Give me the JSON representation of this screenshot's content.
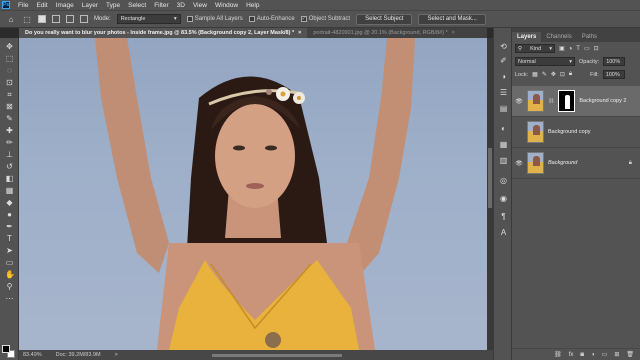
{
  "menubar": {
    "items": [
      "File",
      "Edit",
      "Image",
      "Layer",
      "Type",
      "Select",
      "Filter",
      "3D",
      "View",
      "Window",
      "Help"
    ]
  },
  "options": {
    "mode_label": "Mode:",
    "mode_value": "Rectangle",
    "sample_all_layers": "Sample All Layers",
    "auto_enhance": "Auto-Enhance",
    "object_subtract": "Object Subtract",
    "select_subject": "Select Subject",
    "select_and_mask": "Select and Mask..."
  },
  "tabs": [
    {
      "label": "Do you really want to blur your photos - Inside frame.jpg @ 83.5% (Background copy 2, Layer Mask/8) *",
      "close": "×"
    },
    {
      "label": "portrait-4820901.jpg @ 20.1% (Background, RGB/8#) *",
      "close": "×"
    }
  ],
  "status": {
    "zoom": "83.49%",
    "doc": "Doc: 39.2M/83.9M",
    "more": ">"
  },
  "layers_panel": {
    "tabs": [
      "Layers",
      "Channels",
      "Paths"
    ],
    "kind_label": "Kind",
    "blend_mode": "Normal",
    "opacity_label": "Opacity:",
    "opacity_value": "100%",
    "lock_label": "Lock:",
    "fill_label": "Fill:",
    "fill_value": "100%",
    "layers": [
      {
        "name": "Background copy 2",
        "visible": true,
        "selected": true,
        "has_mask": true
      },
      {
        "name": "Background copy",
        "visible": false,
        "selected": false,
        "has_mask": false
      },
      {
        "name": "Background",
        "visible": true,
        "selected": false,
        "has_mask": false,
        "locked": true
      }
    ],
    "footer_icons": [
      "link-icon",
      "fx-icon",
      "mask-icon",
      "adjustment-icon",
      "group-icon",
      "new-layer-icon",
      "trash-icon"
    ]
  },
  "colors": {
    "panel": "#535353",
    "dark": "#424242",
    "selected": "#6a6a6a",
    "dress": "#e8b23c",
    "sky": "#9cadc7"
  }
}
